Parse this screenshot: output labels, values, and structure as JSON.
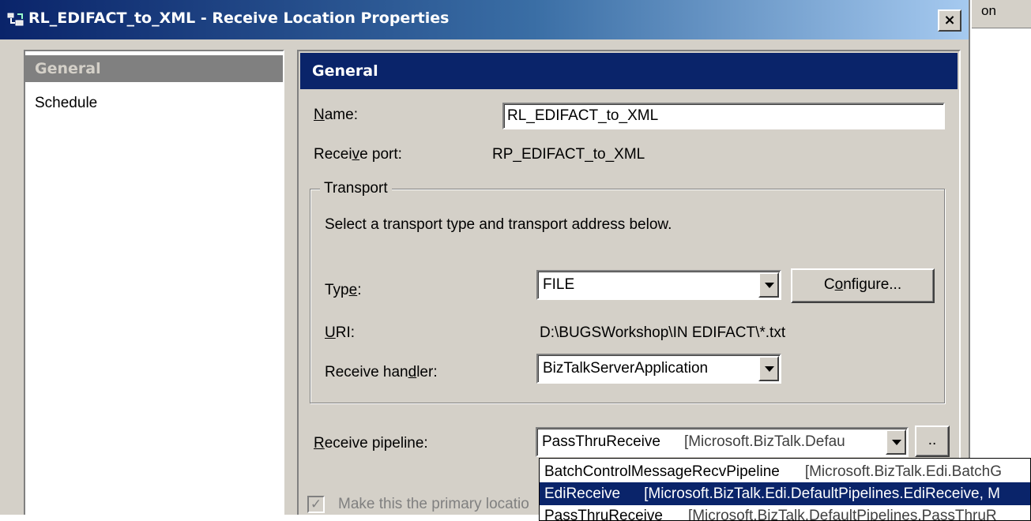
{
  "window": {
    "title": "RL_EDIFACT_to_XML - Receive Location Properties",
    "close_glyph": "×"
  },
  "background_window": {
    "header_text": "on"
  },
  "nav": {
    "items": [
      {
        "label": "General",
        "selected": true
      },
      {
        "label": "Schedule",
        "selected": false
      }
    ]
  },
  "content": {
    "section_title": "General",
    "name_label_ul": "N",
    "name_label_rest": "ame:",
    "name_value": "RL_EDIFACT_to_XML",
    "receive_port_label_a": "Recei",
    "receive_port_label_ul": "v",
    "receive_port_label_b": "e port:",
    "receive_port_value": "RP_EDIFACT_to_XML",
    "transport": {
      "group_title": "Transport",
      "description": "Select a transport type and transport address below.",
      "type_label_a": "Typ",
      "type_label_ul": "e",
      "type_label_b": ":",
      "type_value": "FILE",
      "configure_a": "C",
      "configure_ul": "o",
      "configure_b": "nfigure...",
      "uri_label_ul": "U",
      "uri_label_rest": "RI:",
      "uri_value": "D:\\BUGSWorkshop\\IN EDIFACT\\*.txt",
      "handler_label_a": "Receive han",
      "handler_label_ul": "d",
      "handler_label_b": "ler:",
      "handler_value": "BizTalkServerApplication"
    },
    "pipeline": {
      "label_ul": "R",
      "label_rest": "eceive pipeline:",
      "selected_name": "PassThruReceive",
      "selected_assembly": "[Microsoft.BizTalk.Defau",
      "browse_label": "..",
      "options": [
        {
          "name": "BatchControlMessageRecvPipeline",
          "assembly": "[Microsoft.BizTalk.Edi.BatchG",
          "highlighted": false
        },
        {
          "name": "EdiReceive",
          "assembly": "[Microsoft.BizTalk.Edi.DefaultPipelines.EdiReceive, M",
          "highlighted": true
        },
        {
          "name": "PassThruReceive",
          "assembly": "[Microsoft.BizTalk.DefaultPipelines.PassThruR",
          "highlighted": false
        }
      ]
    },
    "primary_location": {
      "label": "Make this the primary locatio",
      "checked": true,
      "disabled": true,
      "check_glyph": "✓"
    }
  },
  "colors": {
    "dialog_face": "#d4d0c8",
    "title_gradient_start": "#0a246a",
    "section_header": "#0a246a",
    "selection_highlight": "#0a246a"
  }
}
